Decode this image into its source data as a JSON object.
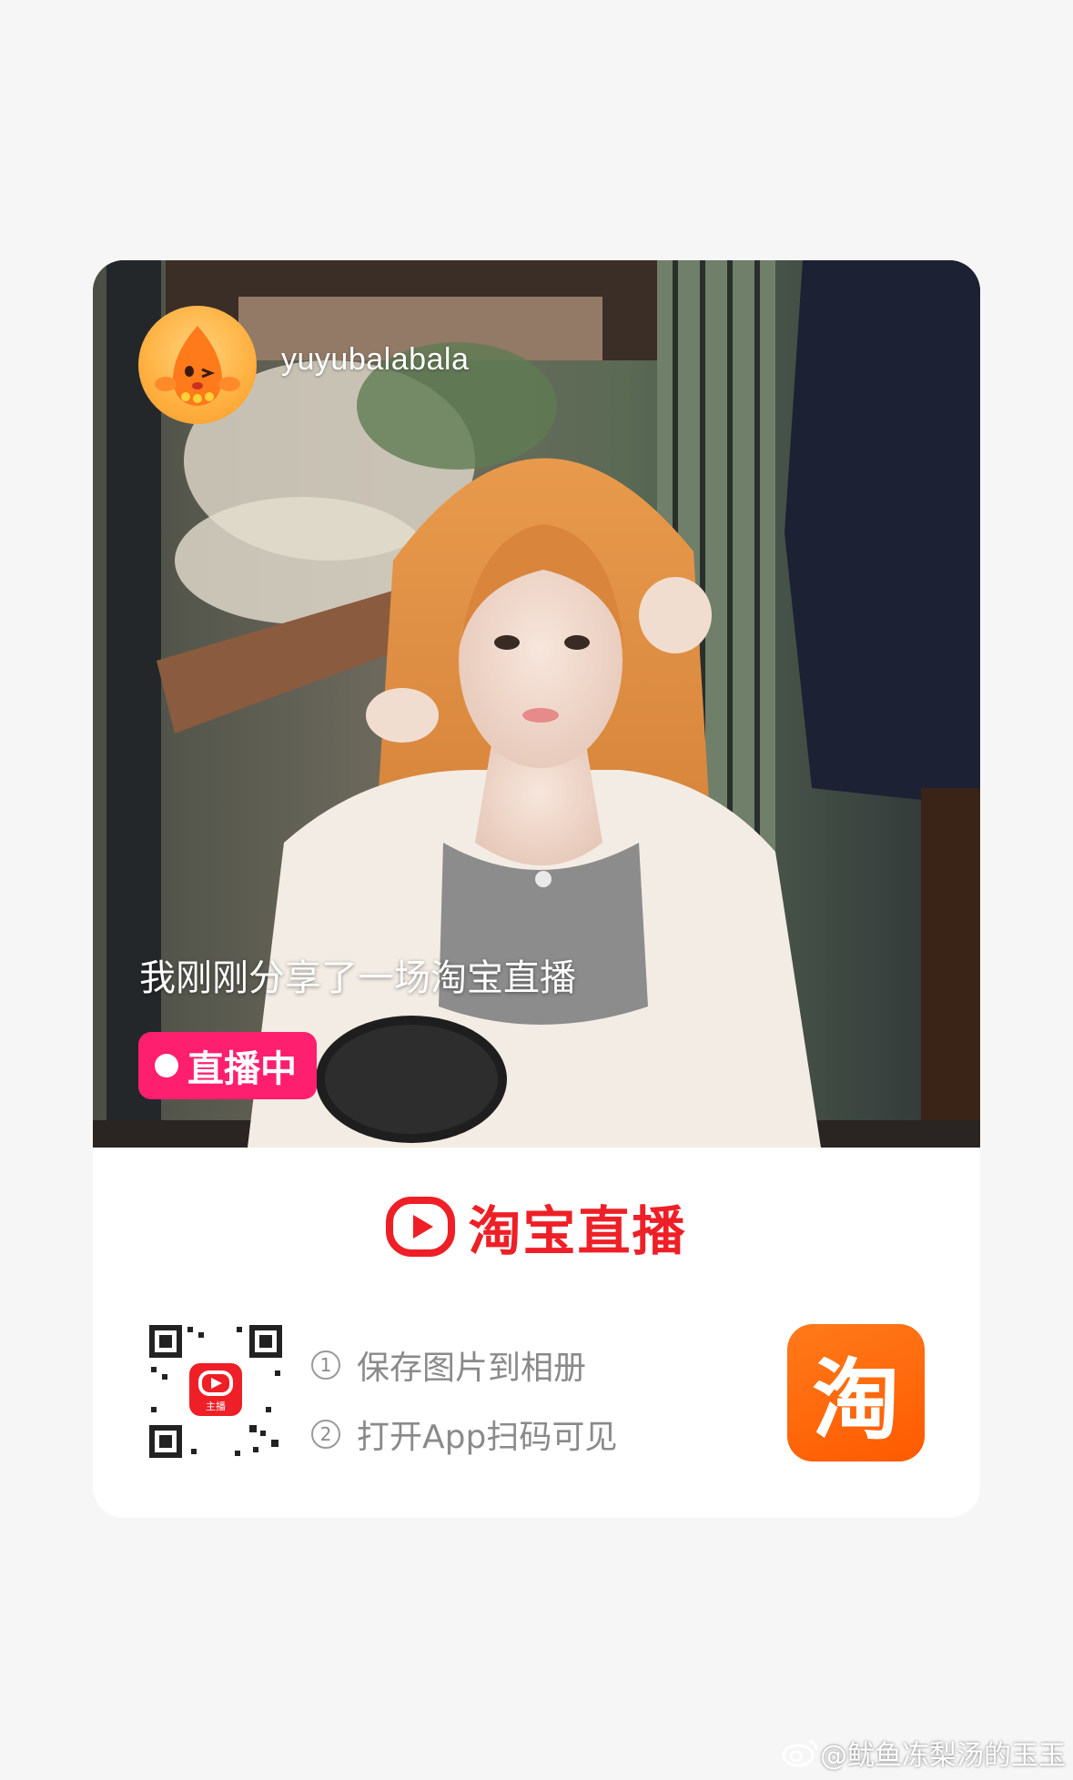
{
  "post": {
    "username": "yuyubalabala",
    "share_text": "我刚刚分享了一场淘宝直播",
    "live_badge": "直播中"
  },
  "brand": {
    "name": "淘宝直播",
    "color": "#ee1f26"
  },
  "qr_section": {
    "steps": [
      {
        "num": "1",
        "text": "保存图片到相册"
      },
      {
        "num": "2",
        "text": "打开App扫码可见"
      }
    ],
    "qr_center_label": "主播"
  },
  "taobao_app": {
    "glyph": "淘",
    "color": "#ff6a00"
  },
  "watermark": {
    "text": "@鱿鱼冻梨汤的玉玉"
  },
  "icons": [
    "taobao-live-play-icon",
    "weibo-logo-icon",
    "live-dot-icon",
    "mascot-avatar-icon"
  ]
}
